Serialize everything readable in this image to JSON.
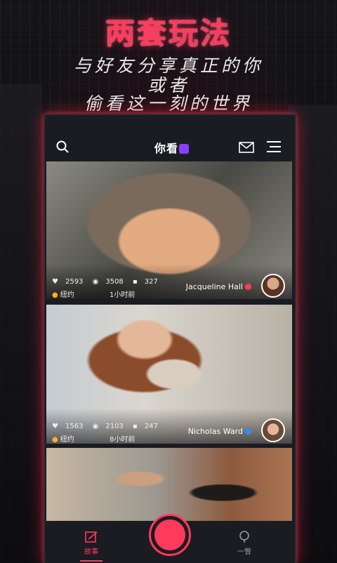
{
  "promo": {
    "headline": "两套玩法",
    "line1": "与好友分享真正的你",
    "line2": "或者",
    "line3": "偷看这一刻的世界"
  },
  "app": {
    "logo_text": "你看",
    "accent_color": "#ff3a5b"
  },
  "feed": [
    {
      "likes": "2593",
      "views": "3508",
      "comments": "327",
      "location": "纽约",
      "time": "1小时前",
      "author": "Jacqueline Hall",
      "badge_color": "#ff3a5b"
    },
    {
      "likes": "1563",
      "views": "2103",
      "comments": "247",
      "location": "纽约",
      "time": "8小时前",
      "author": "Nicholas Ward",
      "badge_color": "#2d8cff"
    }
  ],
  "tabs": {
    "stories": "故事",
    "peek": "一瞥"
  },
  "icons": [
    "search-icon",
    "mail-icon",
    "menu-icon",
    "heart-icon",
    "eye-icon",
    "comment-icon",
    "location-pin-icon",
    "stories-icon",
    "record-icon",
    "peek-icon"
  ]
}
